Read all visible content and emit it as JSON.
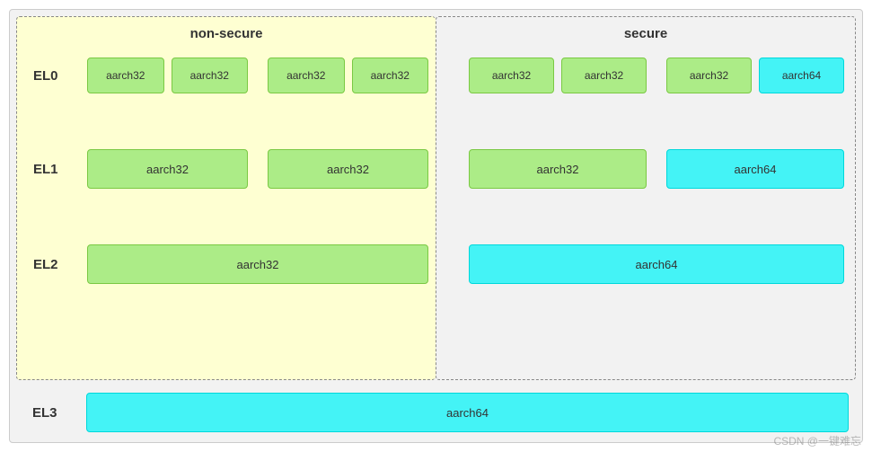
{
  "panels": {
    "non_secure": "non-secure",
    "secure": "secure"
  },
  "labels": {
    "el0": "EL0",
    "el1": "EL1",
    "el2": "EL2",
    "el3": "EL3"
  },
  "arch": {
    "a32": "aarch32",
    "a64": "aarch64"
  },
  "watermark": "CSDN @一键难忘"
}
